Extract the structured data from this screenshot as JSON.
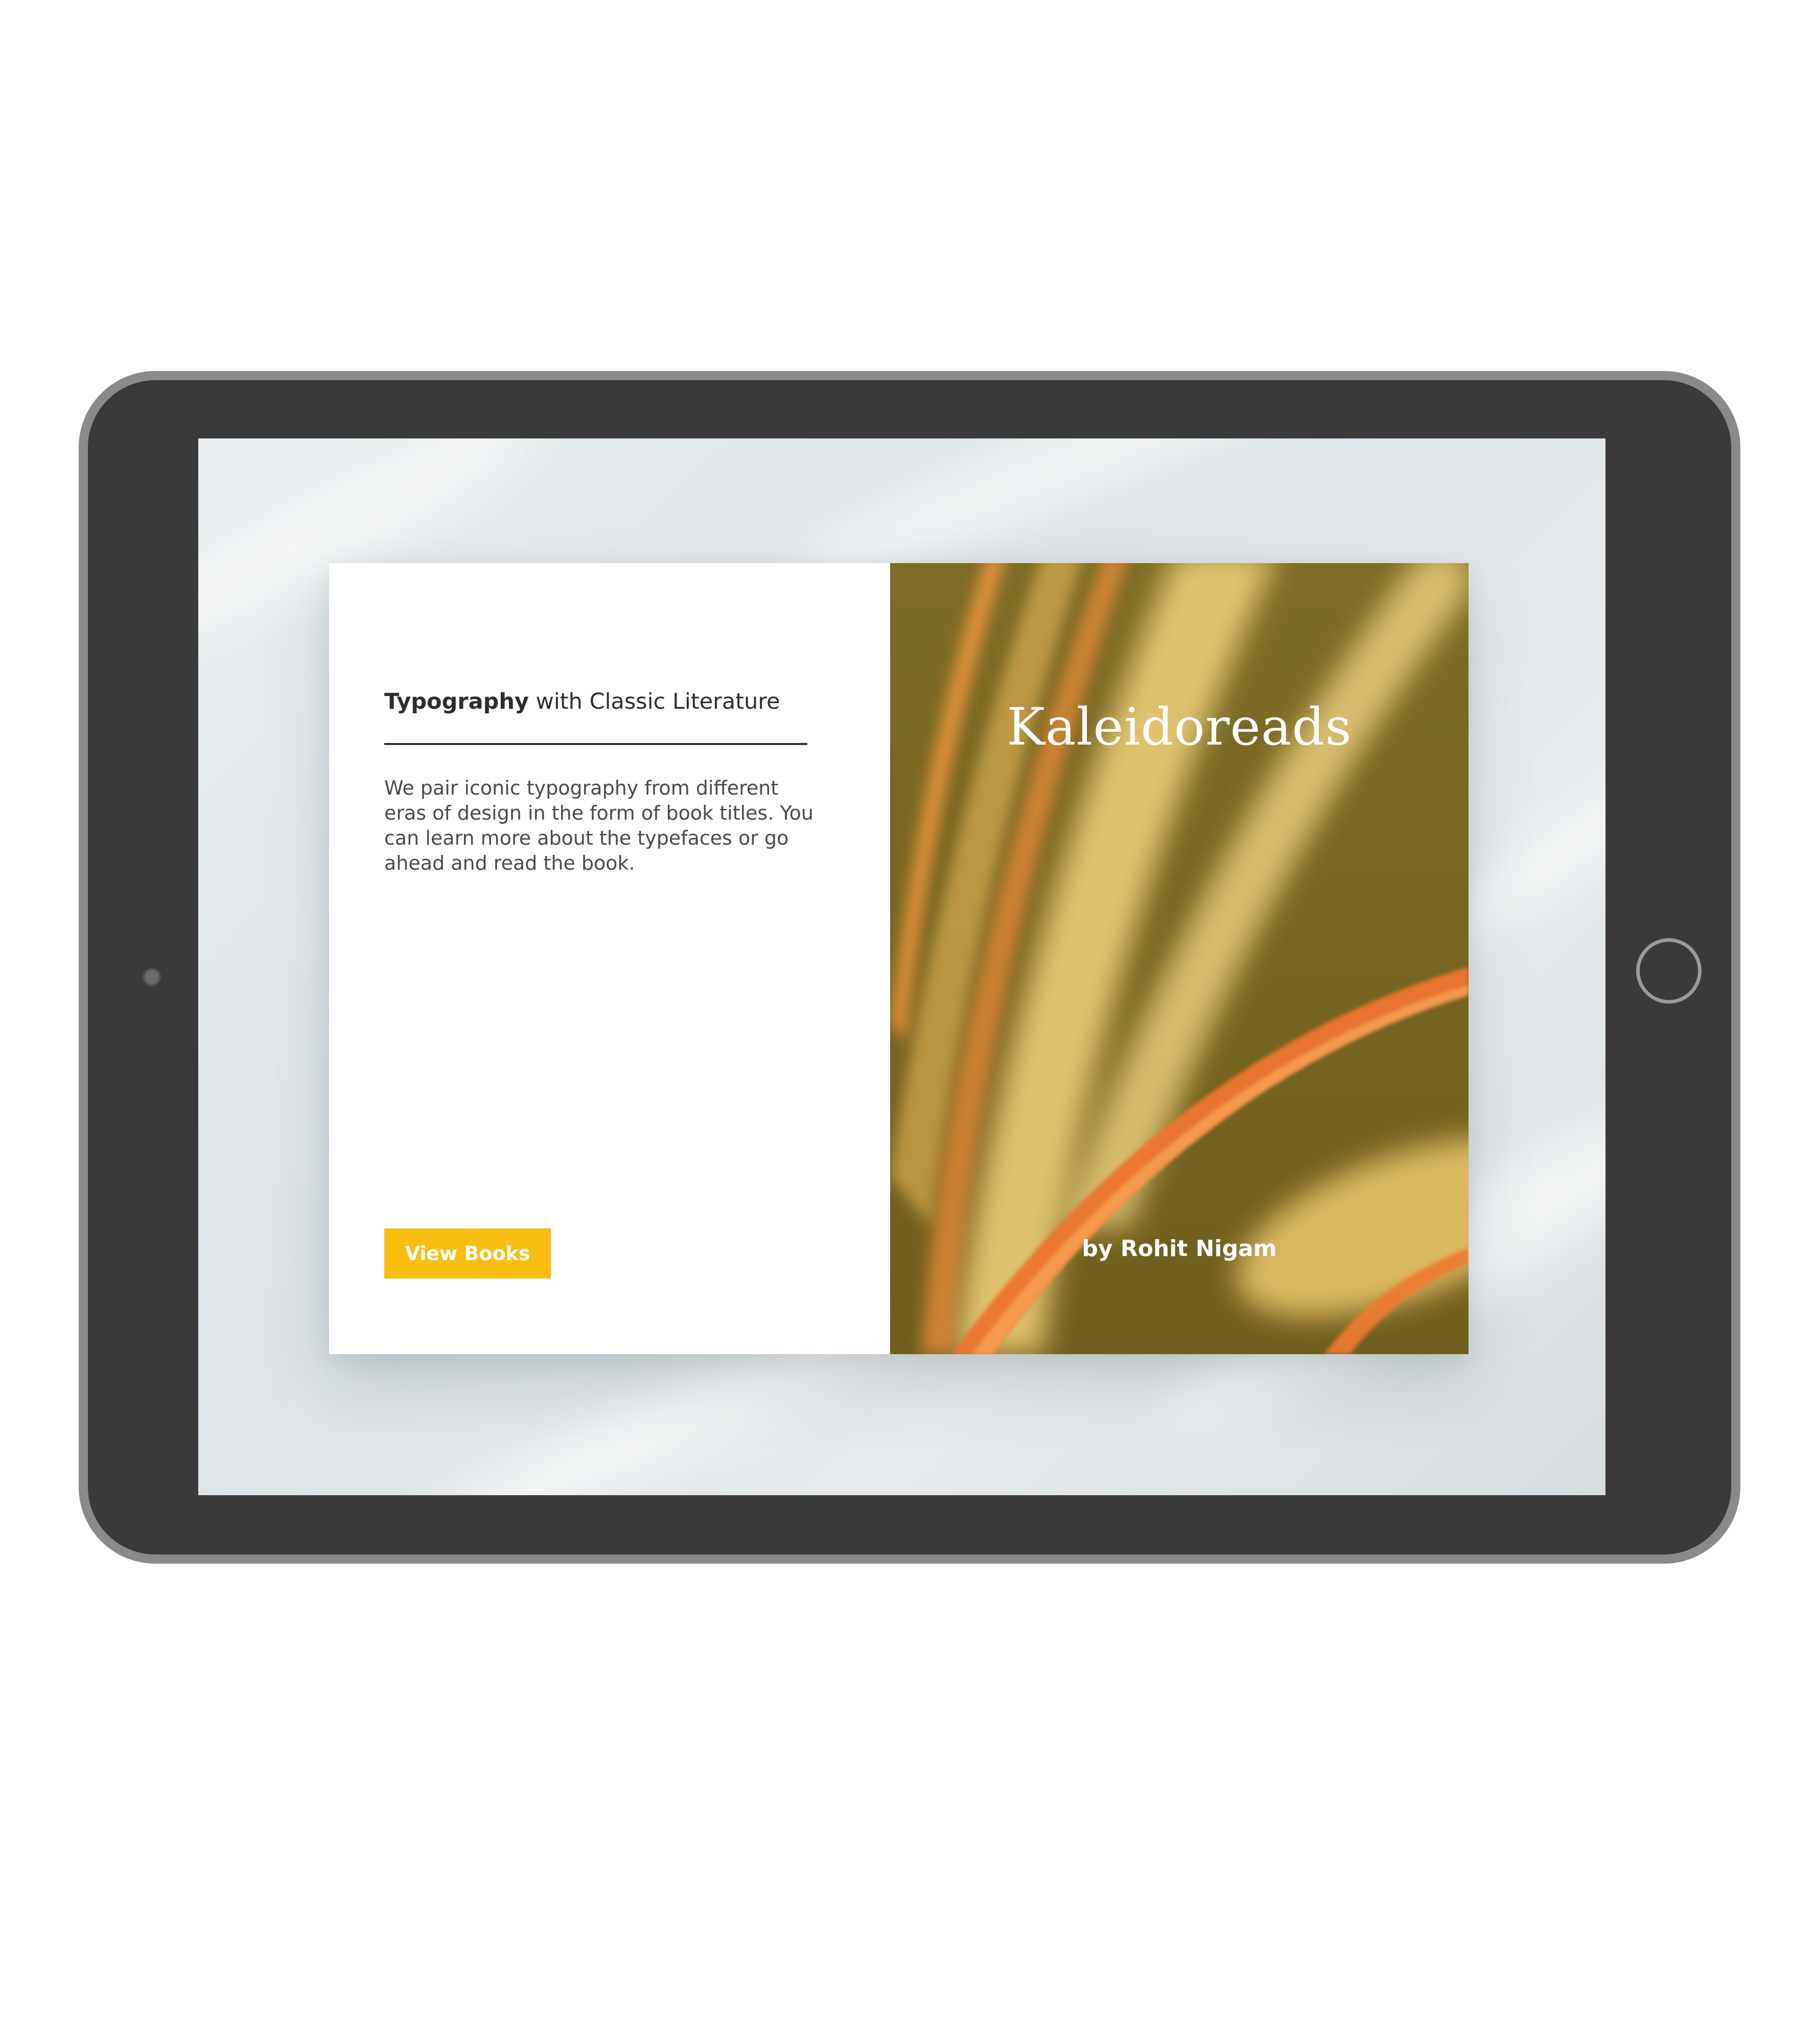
{
  "book": {
    "headline_bold": "Typography",
    "headline_rest": " with Classic Literature",
    "description": "We pair iconic typography from different eras of design in the form of book titles. You can learn more about the typefaces or go ahead and read the book.",
    "cta_label": "View Books",
    "cover_title": "Kaleidoreads",
    "cover_author": "by Rohit Nigam"
  },
  "colors": {
    "cta_background": "#f7be10",
    "cover_base": "#7a6a22",
    "cover_accent_orange": "#f07a2a",
    "cover_accent_yellow": "#f6d57a",
    "device_frame": "#3a3a3a"
  }
}
